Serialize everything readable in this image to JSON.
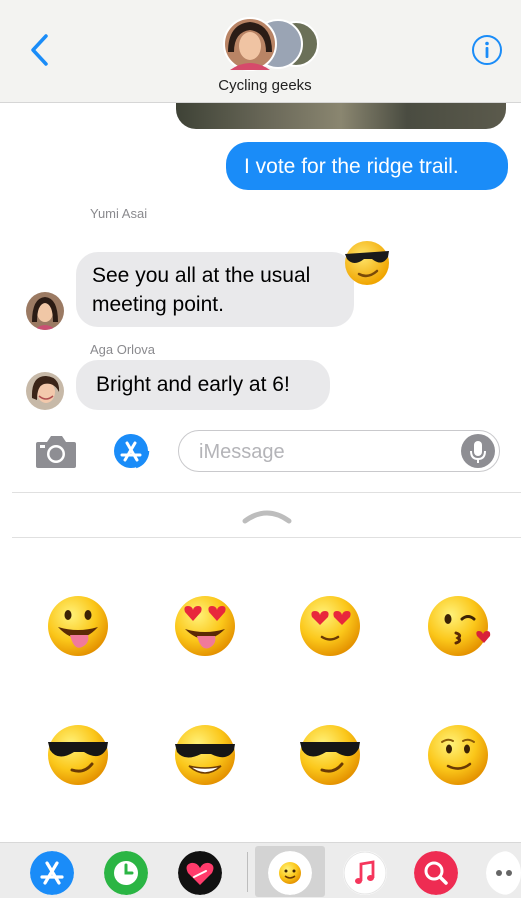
{
  "header": {
    "group_name": "Cycling geeks",
    "back_icon": "chevron-left-icon",
    "info_icon": "info-icon"
  },
  "messages": [
    {
      "direction": "sent",
      "text": "I vote for the ridge trail."
    },
    {
      "direction": "received",
      "sender": "Yumi Asai",
      "text": "See you all at the usual meeting point."
    },
    {
      "direction": "received",
      "sender": "Aga Orlova",
      "text": "Bright and early at 6!"
    }
  ],
  "composer": {
    "placeholder": "iMessage",
    "camera_icon": "camera-icon",
    "apps_icon": "app-store-icon",
    "mic_icon": "microphone-icon"
  },
  "sticker_drawer": {
    "handle_icon": "chevron-up-icon",
    "stickers": [
      "grinning-tongue-emoji",
      "heart-eyes-tongue-emoji",
      "heart-eyes-emoji",
      "kiss-wink-emoji",
      "sunglasses-smirk-emoji",
      "sunglasses-grin-emoji",
      "sunglasses-smirk-emoji",
      "slight-smile-emoji"
    ]
  },
  "app_bar": {
    "apps": [
      "app-store-icon",
      "recents-clock-icon",
      "digital-touch-heart-icon",
      "emoji-stickers-icon",
      "music-icon",
      "web-images-search-icon",
      "more-icon"
    ],
    "selected": "emoji-stickers-icon"
  },
  "colors": {
    "accent": "#1a8cf8",
    "received_bubble": "#e9e9eb",
    "header_bg": "#f3f3f1"
  }
}
